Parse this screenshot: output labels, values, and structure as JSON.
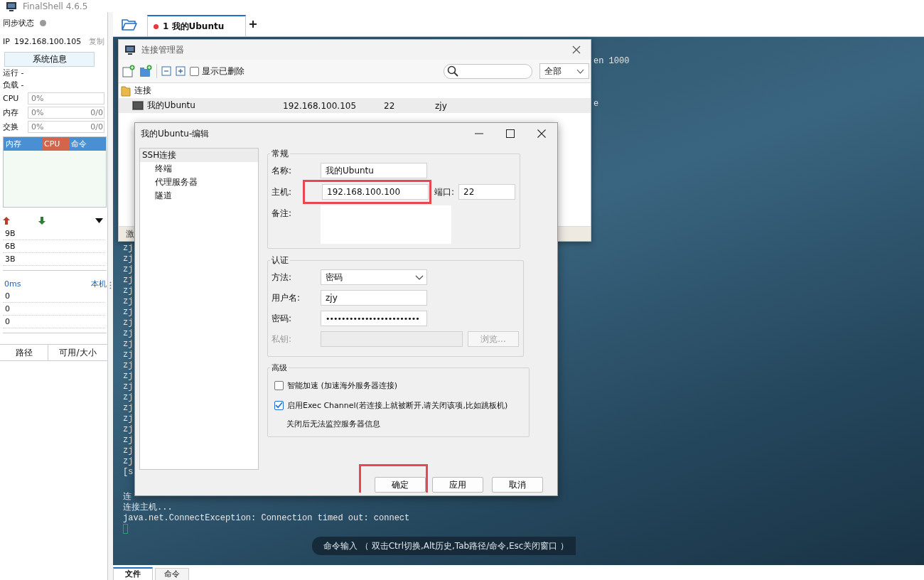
{
  "app": {
    "title": "FinalShell 4.6.5"
  },
  "sidebar": {
    "sync": {
      "label": "同步状态",
      "online": false
    },
    "ip": {
      "label": "IP",
      "value": "192.168.100.105",
      "copy": "复制"
    },
    "sysinfo_button": "系统信息",
    "stats": [
      "运行 -",
      "负载 -"
    ],
    "meters": [
      {
        "label": "CPU",
        "reading": "0%",
        "level": 0
      },
      {
        "label": "内存",
        "reading": "0%",
        "extra": "0/0",
        "level": 0
      },
      {
        "label": "交换",
        "reading": "0%",
        "extra": "0/0",
        "level": 0
      }
    ],
    "monitor_tabs": [
      {
        "label": "内存",
        "selected": false
      },
      {
        "label": "CPU",
        "selected": true
      },
      {
        "label": "命令",
        "selected": false
      }
    ],
    "net_scale": [
      "9B",
      "6B",
      "3B"
    ],
    "ping": {
      "reading": "0ms",
      "host": "本机",
      "scale": [
        "0",
        "0",
        "0"
      ]
    },
    "disk_columns": [
      "路径",
      "可用/大小"
    ]
  },
  "tabs": [
    {
      "label": "1 我的Ubuntu",
      "selected": true,
      "connected": false
    }
  ],
  "terminal": {
    "top_fragments": [
      "en 1000",
      "e"
    ],
    "blocks": [
      [
        "zj",
        "zj",
        "zj",
        "zj",
        "zj",
        "zj",
        "zj",
        "zj",
        "zj",
        "zj",
        "zj",
        "zj",
        "zj",
        "zj",
        "zj",
        "zj",
        "zj",
        "zj",
        "zj",
        "zj",
        "zj",
        "[s"
      ],
      [
        "连",
        "连接主机...",
        "java.net.ConnectException: Connection timed out: connect"
      ]
    ],
    "command_hint": "命令输入 （ 双击Ctrl切换,Alt历史,Tab路径/命令,Esc关闭窗口 ）"
  },
  "bottom_tabs": [
    {
      "label": "文件",
      "selected": true
    },
    {
      "label": "命令",
      "selected": false
    }
  ],
  "connection_manager": {
    "title": "连接管理器",
    "show_deleted": {
      "label": "显示已删除",
      "checked": false
    },
    "filter": "全部",
    "tree": [
      {
        "kind": "folder",
        "label": "连接",
        "children": [
          {
            "kind": "connection",
            "label": "我的Ubuntu",
            "host": "192.168.100.105",
            "port": "22",
            "user": "zjy",
            "selected": true
          }
        ]
      }
    ],
    "status": "激"
  },
  "edit_dialog": {
    "title": "我的Ubuntu-编辑",
    "nav": [
      {
        "label": "SSH连接",
        "selected": true,
        "children": [
          {
            "label": "终端",
            "selected": false
          },
          {
            "label": "代理服务器",
            "selected": false
          },
          {
            "label": "隧道",
            "selected": false
          }
        ]
      }
    ],
    "general": {
      "title": "常规",
      "name": {
        "label": "名称:",
        "value": "我的Ubuntu"
      },
      "host": {
        "label": "主机:",
        "value": "192.168.100.100",
        "highlighted": true
      },
      "port": {
        "label": "端口:",
        "value": "22"
      },
      "notes": {
        "label": "备注:"
      }
    },
    "auth": {
      "title": "认证",
      "method": {
        "label": "方法:",
        "value": "密码"
      },
      "username": {
        "label": "用户名:",
        "value": "zjy"
      },
      "password": {
        "label": "密码:",
        "value": "••••••••••••••••••••••••"
      },
      "private_key": {
        "label": "私钥:",
        "disabled": true
      },
      "browse": {
        "label": "浏览...",
        "disabled": true
      }
    },
    "advanced": {
      "title": "高级",
      "options": [
        {
          "label": "智能加速 (加速海外服务器连接)",
          "checked": false
        },
        {
          "label": "启用Exec Channel(若连接上就被断开,请关闭该项,比如跳板机)",
          "checked": true,
          "note": "关闭后无法监控服务器信息"
        }
      ]
    },
    "buttons": [
      {
        "label": "确定",
        "highlighted": true
      },
      {
        "label": "应用",
        "highlighted": false
      },
      {
        "label": "取消",
        "highlighted": false
      }
    ]
  }
}
